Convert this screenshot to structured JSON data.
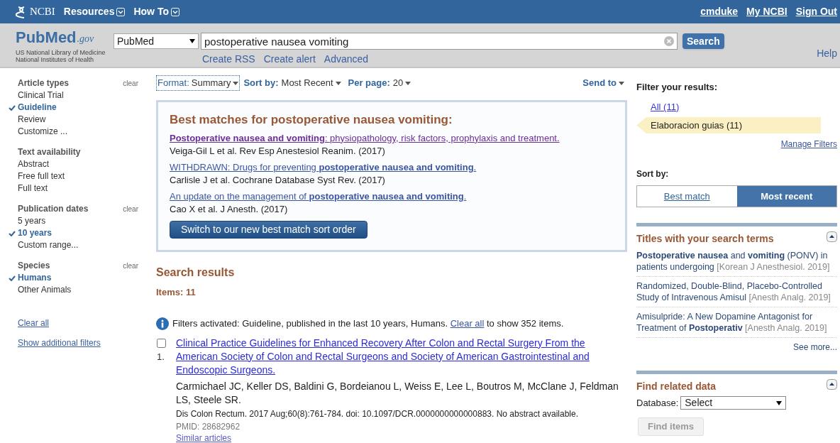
{
  "ncbi_bar": {
    "brand": "NCBI",
    "menus": [
      "Resources",
      "How To"
    ],
    "user_links": [
      "cmduke",
      "My NCBI",
      "Sign Out"
    ]
  },
  "header": {
    "logo": "PubMed",
    "logo_suffix": ".gov",
    "subtitle": [
      "US National Library of Medicine",
      "National Institutes of Health"
    ],
    "database": "PubMed",
    "query": "postoperative nausea vomiting",
    "search_button": "Search",
    "links": [
      "Create RSS",
      "Create alert",
      "Advanced"
    ],
    "help": "Help"
  },
  "sidebar": {
    "groups": [
      {
        "title": "Article types",
        "clear": "clear",
        "items": [
          {
            "label": "Clinical Trial",
            "selected": false
          },
          {
            "label": "Guideline",
            "selected": true
          },
          {
            "label": "Review",
            "selected": false
          },
          {
            "label": "Customize ...",
            "selected": false
          }
        ]
      },
      {
        "title": "Text availability",
        "items": [
          {
            "label": "Abstract",
            "selected": false
          },
          {
            "label": "Free full text",
            "selected": false
          },
          {
            "label": "Full text",
            "selected": false
          }
        ]
      },
      {
        "title": "Publication dates",
        "clear": "clear",
        "items": [
          {
            "label": "5 years",
            "selected": false
          },
          {
            "label": "10 years",
            "selected": true
          },
          {
            "label": "Custom range...",
            "selected": false
          }
        ]
      },
      {
        "title": "Species",
        "clear": "clear",
        "items": [
          {
            "label": "Humans",
            "selected": true
          },
          {
            "label": "Other Animals",
            "selected": false
          }
        ]
      }
    ],
    "links": [
      "Clear all",
      "Show additional filters"
    ]
  },
  "toolbar": {
    "format_label": "Format:",
    "format": "Summary",
    "sort_label": "Sort by:",
    "sort": "Most Recent",
    "per_page_label": "Per page:",
    "per_page": "20",
    "send_to": "Send to"
  },
  "best_matches": {
    "heading": "Best matches for postoperative nausea vomiting:",
    "items": [
      {
        "title": "**Postoperative nausea and vomiting**: physiopathology, risk factors, prophylaxis and treatment.",
        "visited": true,
        "citation": "Veiga-Gil L et al. Rev Esp Anestesiol Reanim. (2017)"
      },
      {
        "title": "WITHDRAWN: Drugs for preventing **postoperative nausea and vomiting**.",
        "visited": false,
        "citation": "Carlisle J et al. Cochrane Database Syst Rev. (2017)"
      },
      {
        "title": "An update on the management of **postoperative nausea and vomiting**.",
        "visited": false,
        "citation": "Cao X et al. J Anesth. (2017)"
      }
    ],
    "button": "Switch to our new best match sort order"
  },
  "results": {
    "heading": "Search results",
    "count": "Items: 11",
    "notice": {
      "text": "Filters activated: Guideline, published in the last 10 years, Humans.",
      "link": "Clear all",
      "after": "to show 352 items."
    },
    "items": [
      {
        "number": "1.",
        "checked": false,
        "title": "Clinical Practice Guidelines for Enhanced Recovery After Colon and Rectal Surgery From the American Society of Colon and Rectal Surgeons and Society of American Gastrointestinal and Endoscopic Surgeons.",
        "authors": "Carmichael JC, Keller DS, Baldini G, Bordeianou L, Weiss E, Lee L, Boutros M, McClane J, Feldman LS, Steele SR.",
        "citation": "Dis Colon Rectum. 2017 Aug;60(8):761-784. doi: 10.1097/DCR.0000000000000883. No abstract available.",
        "pmid": "PMID: 28682962",
        "similar": "Similar articles"
      }
    ]
  },
  "right": {
    "filter_title": "Filter your results:",
    "filters": [
      {
        "label": "All (11)",
        "selected": false
      },
      {
        "label": "Elaboracion guias (11)",
        "selected": true
      }
    ],
    "manage": "Manage Filters",
    "sort_title": "Sort by:",
    "sort_options": [
      {
        "label": "Best match",
        "selected": false
      },
      {
        "label": "Most recent",
        "selected": true
      }
    ],
    "titles_panel": {
      "title": "Titles with your search terms",
      "items": [
        {
          "title": "**Postoperative nausea** and **vomiting** (PONV) in patients undergoing",
          "source": "[Korean J Anesthesiol. 2019]"
        },
        {
          "title": "Randomized, Double-Blind, Placebo-Controlled Study of Intravenous Amisul",
          "source": "[Anesth Analg. 2019]"
        },
        {
          "title": "Amisulpride: A New Dopamine Antagonist for Treatment of **Postoperativ**",
          "source": "[Anesth Analg. 2019]"
        }
      ],
      "more": "See more..."
    },
    "related_panel": {
      "title": "Find related data",
      "database_label": "Database:",
      "database": "Select",
      "button": "Find items",
      "button_disabled": true
    }
  }
}
